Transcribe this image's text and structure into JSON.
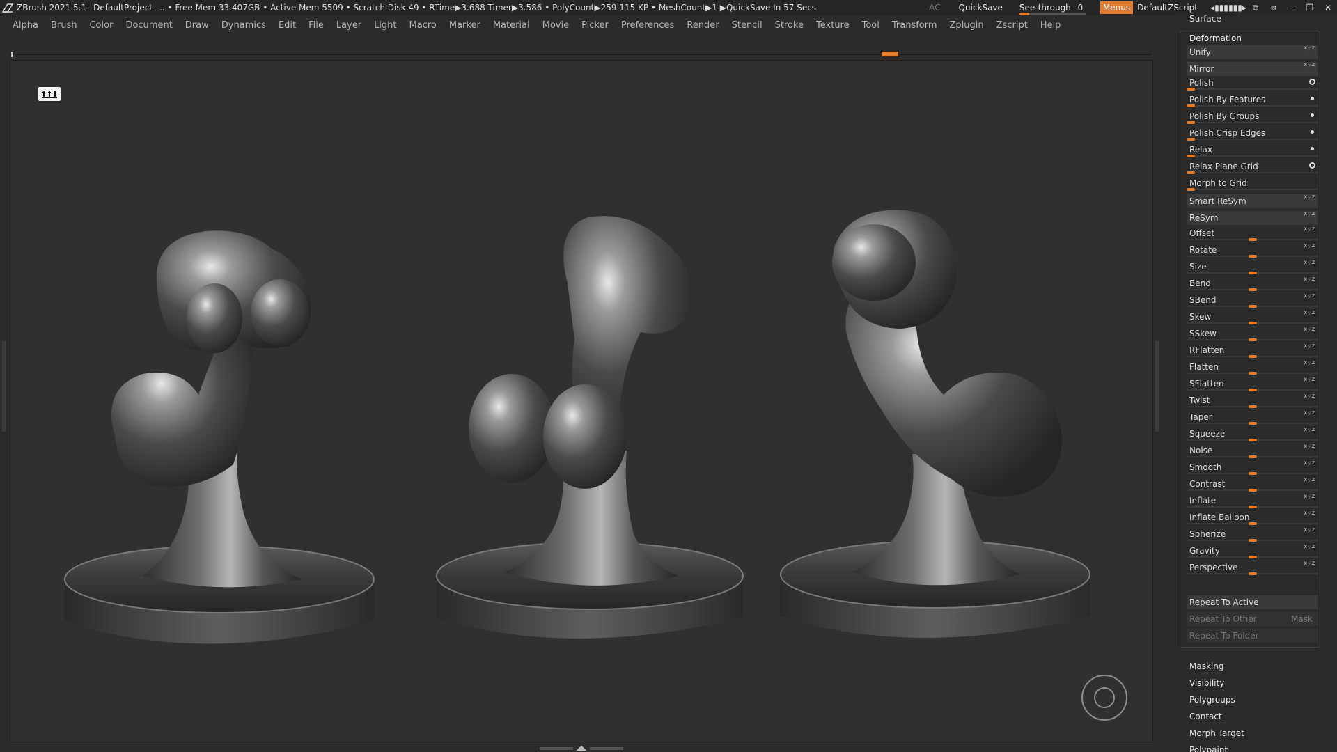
{
  "titlebar": {
    "app": "ZBrush 2021.5.1",
    "project": "DefaultProject",
    "status": ".. • Free Mem 33.407GB • Active Mem 5509 • Scratch Disk 49 •  RTime▶3.688 Timer▶3.586 • PolyCount▶259.115 KP  • MeshCount▶1  ▶QuickSave In 57 Secs",
    "ac": "AC",
    "quicksave": "QuickSave",
    "seethrough_label": "See-through",
    "seethrough_value": "0",
    "seethrough_fraction": 0,
    "menus": "Menus",
    "script": "DefaultZScript",
    "accent": "#e27b2c"
  },
  "menus": [
    "Alpha",
    "Brush",
    "Color",
    "Document",
    "Draw",
    "Dynamics",
    "Edit",
    "File",
    "Layer",
    "Light",
    "Macro",
    "Marker",
    "Material",
    "Movie",
    "Picker",
    "Preferences",
    "Render",
    "Stencil",
    "Stroke",
    "Texture",
    "Tool",
    "Transform",
    "Zplugin",
    "Zscript",
    "Help"
  ],
  "panel": {
    "surface": "Surface",
    "deformation_title": "Deformation",
    "buttons": [
      {
        "label": "Unify",
        "xyz": "xyz"
      },
      {
        "label": "Mirror",
        "xyz": "xyz"
      }
    ],
    "polish_sliders": [
      {
        "label": "Polish",
        "control": "radio"
      },
      {
        "label": "Polish By Features",
        "control": "dot"
      },
      {
        "label": "Polish By Groups",
        "control": "dot"
      },
      {
        "label": "Polish Crisp Edges",
        "control": "dot"
      },
      {
        "label": "Relax",
        "control": "dot"
      },
      {
        "label": "Relax Plane Grid",
        "control": "radio"
      },
      {
        "label": "Morph to Grid",
        "control": "none"
      }
    ],
    "resym_buttons": [
      {
        "label": "Smart ReSym"
      },
      {
        "label": "ReSym"
      }
    ],
    "center_sliders": [
      {
        "label": "Offset"
      },
      {
        "label": "Rotate"
      },
      {
        "label": "Size"
      },
      {
        "label": "Bend"
      },
      {
        "label": "SBend"
      },
      {
        "label": "Skew"
      },
      {
        "label": "SSkew"
      },
      {
        "label": "RFlatten"
      },
      {
        "label": "Flatten"
      },
      {
        "label": "SFlatten"
      },
      {
        "label": "Twist"
      },
      {
        "label": "Taper"
      },
      {
        "label": "Squeeze"
      },
      {
        "label": "Noise"
      },
      {
        "label": "Smooth"
      },
      {
        "label": "Contrast"
      },
      {
        "label": "Inflate"
      },
      {
        "label": "Inflate Balloon"
      },
      {
        "label": "Spherize"
      },
      {
        "label": "Gravity"
      },
      {
        "label": "Perspective"
      }
    ],
    "repeat_active": "Repeat To Active",
    "repeat_other": "Repeat To Other",
    "mask": "Mask",
    "repeat_folder": "Repeat To Folder",
    "sections": [
      "Masking",
      "Visibility",
      "Polygroups",
      "Contact",
      "Morph Target",
      "Polypaint"
    ]
  }
}
